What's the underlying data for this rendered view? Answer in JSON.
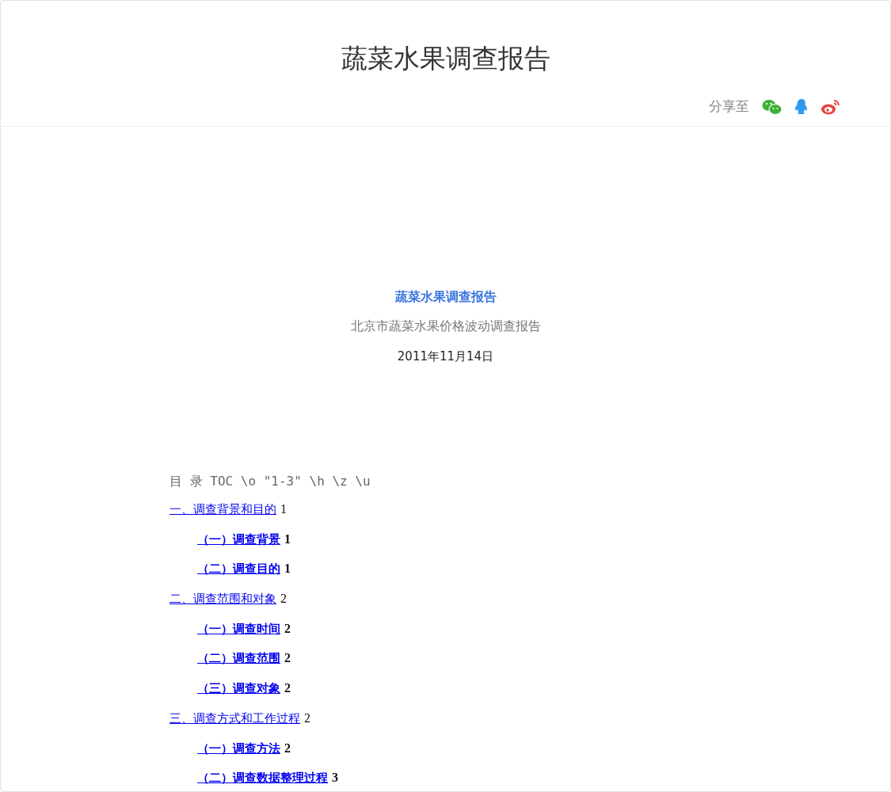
{
  "header": {
    "title": "蔬菜水果调查报告",
    "share_label": "分享至"
  },
  "cover": {
    "title": "蔬菜水果调查报告",
    "subtitle": "北京市蔬菜水果价格波动调查报告",
    "date": "2011年11月14日"
  },
  "toc": {
    "heading": "目 录 TOC \\o \"1-3\" \\h \\z \\u",
    "entries": [
      {
        "label": "一、调查背景和目的",
        "page": "1",
        "children": [
          {
            "label": "（一）调查背景",
            "page": "1"
          },
          {
            "label": "（二）调查目的",
            "page": "1"
          }
        ]
      },
      {
        "label": "二、调查范围和对象",
        "page": "2",
        "children": [
          {
            "label": "（一）调查时间",
            "page": "2"
          },
          {
            "label": "（二）调查范围",
            "page": "2"
          },
          {
            "label": "（三）调查对象",
            "page": "2"
          }
        ]
      },
      {
        "label": "三、调查方式和工作过程",
        "page": "2",
        "children": [
          {
            "label": "（一）调查方法",
            "page": "2"
          },
          {
            "label": "（二）调查数据整理过程",
            "page": "3"
          }
        ]
      }
    ]
  }
}
